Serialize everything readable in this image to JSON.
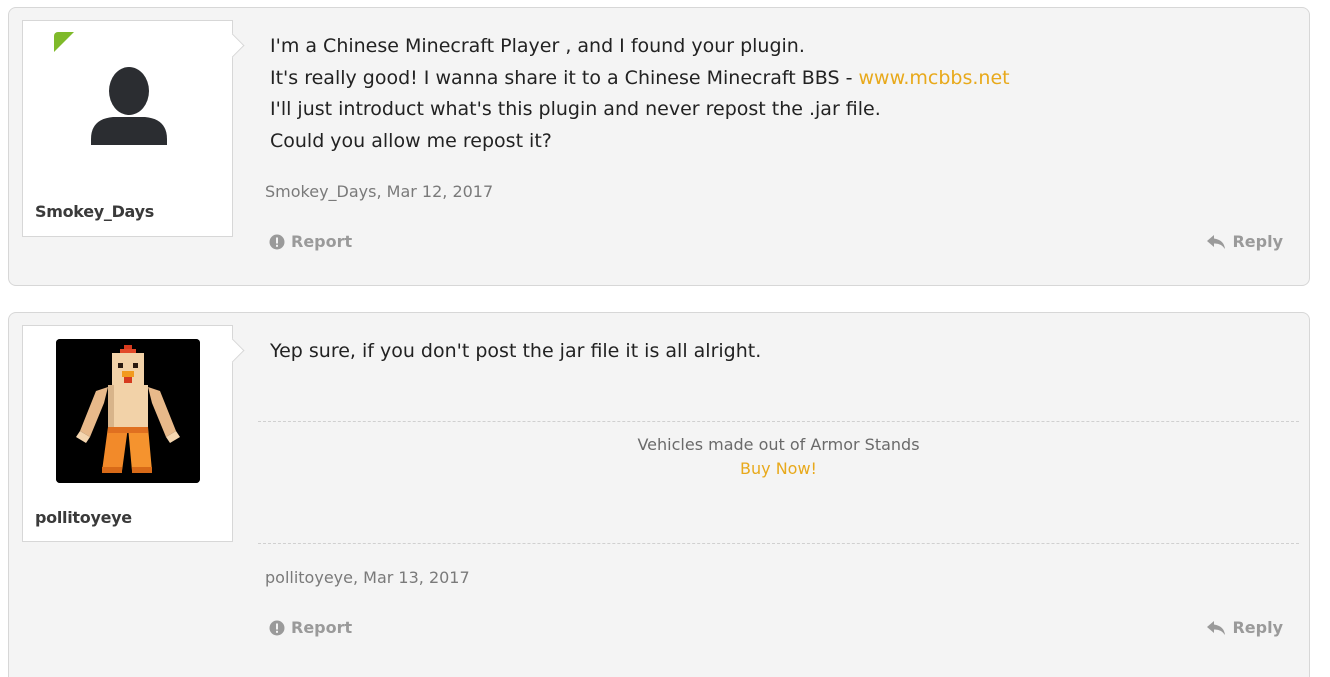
{
  "posts": [
    {
      "username": "Smokey_Days",
      "avatar": "default-silhouette",
      "online": true,
      "message_lines": [
        "I'm a Chinese Minecraft Player , and I found your plugin.",
        "It's really good! I wanna share it to a Chinese Minecraft BBS - ",
        "I'll just introduct what's this plugin and never repost the .jar file.",
        "Could you allow me repost it?"
      ],
      "link_text": "www.mcbbs.net",
      "meta_author": "Smokey_Days",
      "meta_date": "Mar 12, 2017",
      "report_label": "Report",
      "reply_label": "Reply"
    },
    {
      "username": "pollitoyeye",
      "avatar": "chicken-skin",
      "message_lines": [
        "Yep sure, if you don't post the jar file it is all alright."
      ],
      "signature_text": "Vehicles made out of Armor Stands",
      "signature_link": "Buy Now!",
      "meta_author": "pollitoyeye",
      "meta_date": "Mar 13, 2017",
      "report_label": "Report",
      "reply_label": "Reply"
    }
  ],
  "colors": {
    "link": "#e8a91b",
    "online": "#7fba2a",
    "post_bg": "#f4f4f4"
  },
  "icons": {
    "report": "exclamation-circle-icon",
    "reply": "reply-arrow-icon"
  }
}
